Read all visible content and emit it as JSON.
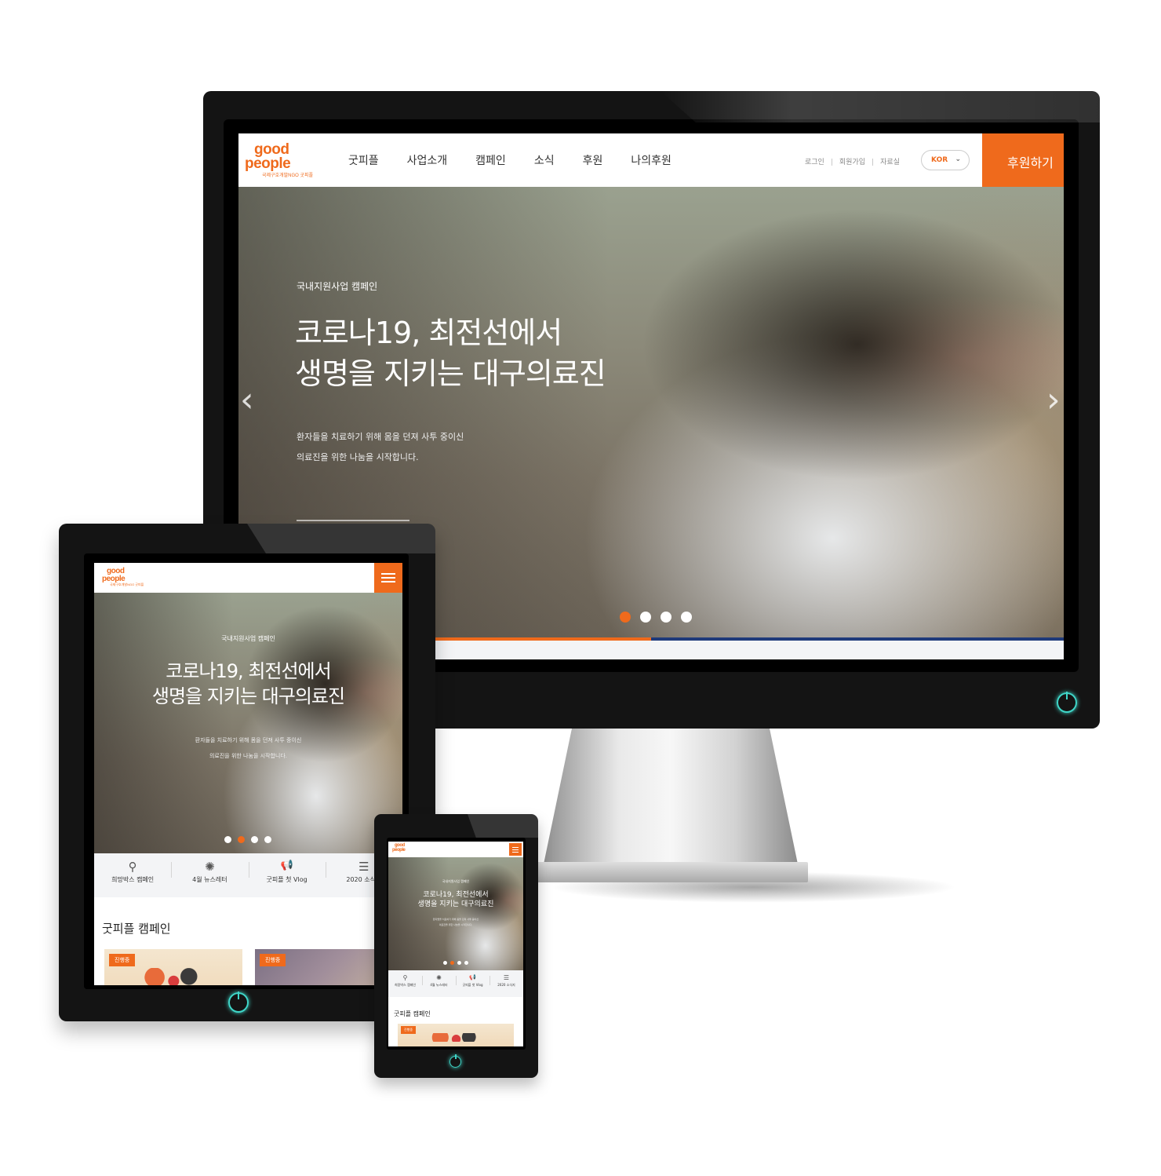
{
  "site": {
    "logo_top": "good",
    "logo_bottom": "people",
    "logo_sub": "국제구호개발NGO 굿피플",
    "nav": [
      "굿피플",
      "사업소개",
      "캠페인",
      "소식",
      "후원",
      "나의후원"
    ],
    "util_links": [
      "로그인",
      "회원가입",
      "자료실"
    ],
    "language": "KOR",
    "donate_label": "후원하기"
  },
  "hero": {
    "kicker": "국내지원사업 캠페인",
    "title": "코로나19, 최전선에서\n생명을 지키는 대구의료진",
    "description": "환자들을 치료하기 위해 몸을 던져 사투 중이신\n의료진을 위한 나눔을 시작합니다.",
    "slide_count": 4,
    "desktop_active_slide": 1,
    "mobile_active_slide": 2,
    "progress": 0.5
  },
  "quick_links": [
    {
      "icon": "search-heart-icon",
      "glyph": "⚲",
      "label": "희망박스 캠페인"
    },
    {
      "icon": "badge-icon",
      "glyph": "✺",
      "label": "4월 뉴스레터"
    },
    {
      "icon": "megaphone-icon",
      "glyph": "📢",
      "label": "굿피플 첫 Vlog"
    },
    {
      "icon": "newspaper-icon",
      "glyph": "☰",
      "label": "2020 소식지"
    }
  ],
  "campaign_section": {
    "title": "굿피플 캠페인",
    "cards": [
      {
        "badge": "진행중"
      },
      {
        "badge": "진행중"
      }
    ]
  },
  "colors": {
    "brand_orange": "#ef6a1c",
    "progress_navy": "#1f3a7a",
    "power_led": "#3fd6c8"
  }
}
